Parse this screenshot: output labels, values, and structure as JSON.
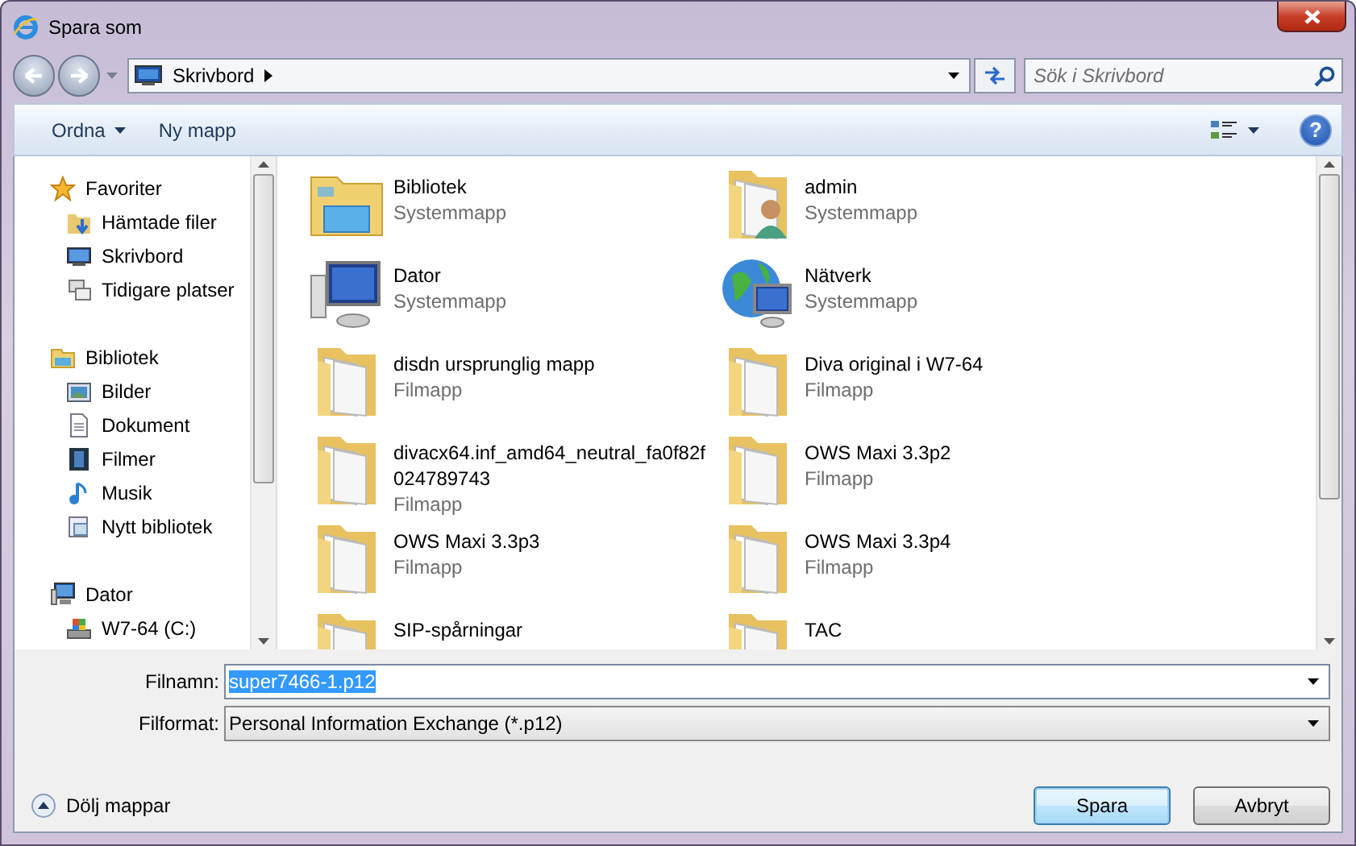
{
  "window": {
    "title": "Spara som"
  },
  "address": {
    "location": "Skrivbord"
  },
  "search": {
    "placeholder": "Sök i Skrivbord"
  },
  "toolbar": [
    {
      "label": "Ordna",
      "dropdown": true
    },
    {
      "label": "Ny mapp",
      "dropdown": false
    }
  ],
  "sidebar": [
    {
      "label": "Favoriter",
      "kind": "star",
      "children": [
        {
          "label": "Hämtade filer",
          "kind": "downloads"
        },
        {
          "label": "Skrivbord",
          "kind": "desktop"
        },
        {
          "label": "Tidigare platser",
          "kind": "recent"
        }
      ]
    },
    {
      "label": "Bibliotek",
      "kind": "library",
      "children": [
        {
          "label": "Bilder",
          "kind": "pictures"
        },
        {
          "label": "Dokument",
          "kind": "documents"
        },
        {
          "label": "Filmer",
          "kind": "videos"
        },
        {
          "label": "Musik",
          "kind": "music"
        },
        {
          "label": "Nytt bibliotek",
          "kind": "newlibrary"
        }
      ]
    },
    {
      "label": "Dator",
      "kind": "computer",
      "children": [
        {
          "label": "W7-64 (C:)",
          "kind": "drive"
        }
      ]
    }
  ],
  "files": [
    {
      "name": "Bibliotek",
      "type": "Systemmapp",
      "kind": "library"
    },
    {
      "name": "admin",
      "type": "Systemmapp",
      "kind": "user"
    },
    {
      "name": "Dator",
      "type": "Systemmapp",
      "kind": "computer"
    },
    {
      "name": "Nätverk",
      "type": "Systemmapp",
      "kind": "network"
    },
    {
      "name": "disdn ursprunglig mapp",
      "type": "Filmapp",
      "kind": "folder"
    },
    {
      "name": "Diva original i W7-64",
      "type": "Filmapp",
      "kind": "folder"
    },
    {
      "name": "divacx64.inf_amd64_neutral_fa0f82f024789743",
      "type": "Filmapp",
      "kind": "folder"
    },
    {
      "name": "OWS Maxi 3.3p2",
      "type": "Filmapp",
      "kind": "folder"
    },
    {
      "name": "OWS Maxi 3.3p3",
      "type": "Filmapp",
      "kind": "folder"
    },
    {
      "name": "OWS Maxi 3.3p4",
      "type": "Filmapp",
      "kind": "folder"
    },
    {
      "name": "SIP-spårningar",
      "kind": "folder"
    },
    {
      "name": "TAC",
      "kind": "folder"
    }
  ],
  "help": {
    "label": "?"
  },
  "filename": {
    "label": "Filnamn:",
    "value": "super7466-1.p12",
    "selected": true
  },
  "format": {
    "label": "Filformat:",
    "value": "Personal Information Exchange (*.p12)"
  },
  "hide_folders": {
    "label": "Dölj mappar"
  },
  "buttons": [
    {
      "label": "Spara",
      "default": true
    },
    {
      "label": "Avbryt",
      "default": false
    }
  ]
}
